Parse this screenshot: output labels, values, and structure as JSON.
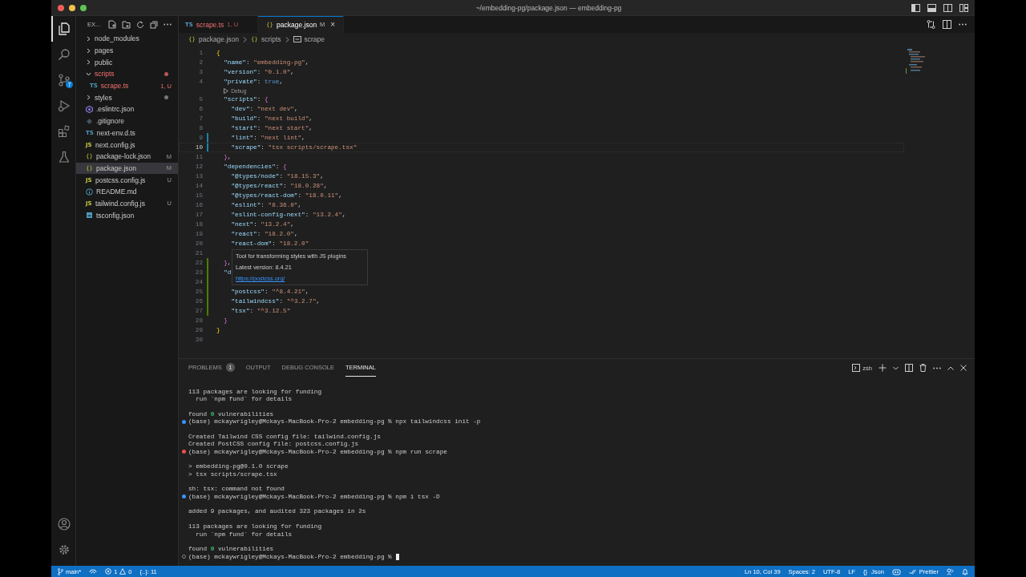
{
  "window": {
    "title": "~/embedding-pg/package.json — embedding-pg"
  },
  "activity_bar": {
    "items": [
      {
        "kind": "explorer",
        "selected": true
      },
      {
        "kind": "search",
        "selected": false
      },
      {
        "kind": "scm",
        "selected": false,
        "badge": "7"
      },
      {
        "kind": "debug",
        "selected": false
      },
      {
        "kind": "extensions",
        "selected": false
      },
      {
        "kind": "testing",
        "selected": false
      }
    ],
    "bottom": [
      {
        "kind": "account"
      },
      {
        "kind": "settings"
      }
    ]
  },
  "sidebar": {
    "title": "EX...",
    "items": [
      {
        "name": "node_modules",
        "kind": "folder",
        "expanded": false,
        "selected": false
      },
      {
        "name": "pages",
        "kind": "folder",
        "expanded": false,
        "selected": false
      },
      {
        "name": "public",
        "kind": "folder",
        "expanded": false,
        "selected": false
      },
      {
        "name": "scripts",
        "kind": "folder",
        "expanded": true,
        "selected": false,
        "error": true,
        "dot": true,
        "children": [
          {
            "name": "scrape.ts",
            "kind": "ts",
            "glyph": "TS",
            "error": true,
            "badge": "1, U",
            "selected": false
          }
        ]
      },
      {
        "name": "styles",
        "kind": "folder",
        "expanded": false,
        "selected": false,
        "dot": true
      },
      {
        "name": ".eslintrc.json",
        "kind": "eslint",
        "selected": false
      },
      {
        "name": ".gitignore",
        "kind": "git",
        "selected": false
      },
      {
        "name": "next-env.d.ts",
        "kind": "ts",
        "glyph": "TS",
        "selected": false
      },
      {
        "name": "next.config.js",
        "kind": "js",
        "glyph": "JS",
        "selected": false
      },
      {
        "name": "package-lock.json",
        "kind": "json",
        "glyph": "{}",
        "badge": "M",
        "selected": false
      },
      {
        "name": "package.json",
        "kind": "json",
        "glyph": "{}",
        "badge": "M",
        "selected": true
      },
      {
        "name": "postcss.config.js",
        "kind": "js",
        "glyph": "JS",
        "badge": "U",
        "selected": false
      },
      {
        "name": "README.md",
        "kind": "info",
        "selected": false
      },
      {
        "name": "tailwind.config.js",
        "kind": "js",
        "glyph": "JS",
        "badge": "U",
        "selected": false
      },
      {
        "name": "tsconfig.json",
        "kind": "tsconfig",
        "selected": false
      }
    ]
  },
  "tabs": [
    {
      "glyph": "TS",
      "kind": "ts",
      "label": "scrape.ts",
      "badge": "1, U",
      "error": true,
      "selected": false
    },
    {
      "glyph": "{}",
      "kind": "json",
      "label": "package.json",
      "badge": "M",
      "selected": true,
      "close": "×"
    }
  ],
  "breadcrumbs": [
    {
      "glyph": "{}",
      "label": "package.json"
    },
    {
      "glyph": "{}",
      "label": "scripts"
    },
    {
      "kind": "property",
      "label": "scrape"
    }
  ],
  "editor": {
    "lines": [
      {
        "kind": "line",
        "num": "1",
        "tokens": [
          {
            "kind": "brace1",
            "t": "{"
          }
        ],
        "children": [
          {
            "kind": "line",
            "num": "2",
            "tokens": [
              {
                "kind": "key",
                "t": "\"name\""
              },
              {
                "kind": "punct",
                "t": ": "
              },
              {
                "kind": "str",
                "t": "\"embedding-pg\""
              },
              {
                "kind": "punct",
                "t": ","
              }
            ]
          },
          {
            "kind": "line",
            "num": "3",
            "tokens": [
              {
                "kind": "key",
                "t": "\"version\""
              },
              {
                "kind": "punct",
                "t": ": "
              },
              {
                "kind": "str",
                "t": "\"0.1.0\""
              },
              {
                "kind": "punct",
                "t": ","
              }
            ]
          },
          {
            "kind": "line",
            "num": "4",
            "tokens": [
              {
                "kind": "key",
                "t": "\"private\""
              },
              {
                "kind": "punct",
                "t": ": "
              },
              {
                "kind": "bool",
                "t": "true"
              },
              {
                "kind": "punct",
                "t": ","
              }
            ]
          },
          {
            "kind": "codelens",
            "label": "Debug"
          },
          {
            "kind": "line",
            "num": "5",
            "tokens": [
              {
                "kind": "key",
                "t": "\"scripts\""
              },
              {
                "kind": "punct",
                "t": ": "
              },
              {
                "kind": "brace2",
                "t": "{"
              }
            ],
            "children": [
              {
                "kind": "line",
                "num": "6",
                "tokens": [
                  {
                    "kind": "key",
                    "t": "\"dev\""
                  },
                  {
                    "kind": "punct",
                    "t": ": "
                  },
                  {
                    "kind": "str",
                    "t": "\"next dev\""
                  },
                  {
                    "kind": "punct",
                    "t": ","
                  }
                ]
              },
              {
                "kind": "line",
                "num": "7",
                "tokens": [
                  {
                    "kind": "key",
                    "t": "\"build\""
                  },
                  {
                    "kind": "punct",
                    "t": ": "
                  },
                  {
                    "kind": "str",
                    "t": "\"next build\""
                  },
                  {
                    "kind": "punct",
                    "t": ","
                  }
                ]
              },
              {
                "kind": "line",
                "num": "8",
                "tokens": [
                  {
                    "kind": "key",
                    "t": "\"start\""
                  },
                  {
                    "kind": "punct",
                    "t": ": "
                  },
                  {
                    "kind": "str",
                    "t": "\"next start\""
                  },
                  {
                    "kind": "punct",
                    "t": ","
                  }
                ]
              },
              {
                "kind": "line",
                "num": "9",
                "changed": true,
                "tokens": [
                  {
                    "kind": "key",
                    "t": "\"lint\""
                  },
                  {
                    "kind": "punct",
                    "t": ": "
                  },
                  {
                    "kind": "str",
                    "t": "\"next lint\""
                  },
                  {
                    "kind": "punct",
                    "t": ","
                  }
                ]
              },
              {
                "kind": "line",
                "num": "10",
                "changed": true,
                "current": true,
                "tokens": [
                  {
                    "kind": "key",
                    "t": "\"scrape\""
                  },
                  {
                    "kind": "punct",
                    "t": ": "
                  },
                  {
                    "kind": "str",
                    "t": "\"tsx scripts/scrape.tsx\""
                  }
                ]
              }
            ]
          },
          {
            "kind": "line",
            "num": "11",
            "tokens": [
              {
                "kind": "brace2",
                "t": "}"
              },
              {
                "kind": "punct",
                "t": ","
              }
            ]
          },
          {
            "kind": "line",
            "num": "12",
            "tokens": [
              {
                "kind": "key",
                "t": "\"dependencies\""
              },
              {
                "kind": "punct",
                "t": ": "
              },
              {
                "kind": "brace2",
                "t": "{"
              }
            ],
            "children": [
              {
                "kind": "line",
                "num": "13",
                "tokens": [
                  {
                    "kind": "key",
                    "t": "\"@types/node\""
                  },
                  {
                    "kind": "punct",
                    "t": ": "
                  },
                  {
                    "kind": "str",
                    "t": "\"18.15.3\""
                  },
                  {
                    "kind": "punct",
                    "t": ","
                  }
                ]
              },
              {
                "kind": "line",
                "num": "14",
                "tokens": [
                  {
                    "kind": "key",
                    "t": "\"@types/react\""
                  },
                  {
                    "kind": "punct",
                    "t": ": "
                  },
                  {
                    "kind": "str",
                    "t": "\"18.0.28\""
                  },
                  {
                    "kind": "punct",
                    "t": ","
                  }
                ]
              },
              {
                "kind": "line",
                "num": "15",
                "tokens": [
                  {
                    "kind": "key",
                    "t": "\"@types/react-dom\""
                  },
                  {
                    "kind": "punct",
                    "t": ": "
                  },
                  {
                    "kind": "str",
                    "t": "\"18.0.11\""
                  },
                  {
                    "kind": "punct",
                    "t": ","
                  }
                ]
              },
              {
                "kind": "line",
                "num": "16",
                "tokens": [
                  {
                    "kind": "key",
                    "t": "\"eslint\""
                  },
                  {
                    "kind": "punct",
                    "t": ": "
                  },
                  {
                    "kind": "str",
                    "t": "\"8.36.0\""
                  },
                  {
                    "kind": "punct",
                    "t": ","
                  }
                ]
              },
              {
                "kind": "line",
                "num": "17",
                "tokens": [
                  {
                    "kind": "key",
                    "t": "\"eslint-config-next\""
                  },
                  {
                    "kind": "punct",
                    "t": ": "
                  },
                  {
                    "kind": "str",
                    "t": "\"13.2.4\""
                  },
                  {
                    "kind": "punct",
                    "t": ","
                  }
                ]
              },
              {
                "kind": "line",
                "num": "18",
                "tokens": [
                  {
                    "kind": "key",
                    "t": "\"next\""
                  },
                  {
                    "kind": "punct",
                    "t": ": "
                  },
                  {
                    "kind": "str",
                    "t": "\"13.2.4\""
                  },
                  {
                    "kind": "punct",
                    "t": ","
                  }
                ]
              },
              {
                "kind": "line",
                "num": "19",
                "tokens": [
                  {
                    "kind": "key",
                    "t": "\"react\""
                  },
                  {
                    "kind": "punct",
                    "t": ": "
                  },
                  {
                    "kind": "str",
                    "t": "\"18.2.0\""
                  },
                  {
                    "kind": "punct",
                    "t": ","
                  }
                ]
              },
              {
                "kind": "line",
                "num": "20",
                "tokens": [
                  {
                    "kind": "key",
                    "t": "\"react-dom\""
                  },
                  {
                    "kind": "punct",
                    "t": ": "
                  },
                  {
                    "kind": "str",
                    "t": "\"18.2.0\""
                  }
                ]
              },
              {
                "kind": "line",
                "num": "21"
              }
            ]
          },
          {
            "kind": "line",
            "num": "22",
            "added": true,
            "tokens": [
              {
                "kind": "brace2",
                "t": "}"
              },
              {
                "kind": "punct",
                "t": ","
              }
            ]
          },
          {
            "kind": "line",
            "num": "23",
            "added": true,
            "tokens": [
              {
                "kind": "key",
                "t": "\"d"
              }
            ],
            "children": [
              {
                "kind": "line",
                "num": "24",
                "added": true
              },
              {
                "kind": "line",
                "num": "25",
                "added": true,
                "tokens": [
                  {
                    "kind": "key",
                    "t": "\"postcss\""
                  },
                  {
                    "kind": "punct",
                    "t": ": "
                  },
                  {
                    "kind": "str",
                    "t": "\"^8.4.21\""
                  },
                  {
                    "kind": "punct",
                    "t": ","
                  }
                ]
              },
              {
                "kind": "line",
                "num": "26",
                "added": true,
                "tokens": [
                  {
                    "kind": "key",
                    "t": "\"tailwindcss\""
                  },
                  {
                    "kind": "punct",
                    "t": ": "
                  },
                  {
                    "kind": "str",
                    "t": "\"^3.2.7\""
                  },
                  {
                    "kind": "punct",
                    "t": ","
                  }
                ]
              },
              {
                "kind": "line",
                "num": "27",
                "added": true,
                "tokens": [
                  {
                    "kind": "key",
                    "t": "\"tsx\""
                  },
                  {
                    "kind": "punct",
                    "t": ": "
                  },
                  {
                    "kind": "str",
                    "t": "\"^3.12.5\""
                  }
                ]
              }
            ]
          },
          {
            "kind": "line",
            "num": "28",
            "tokens": [
              {
                "kind": "brace2",
                "t": "}"
              }
            ]
          }
        ]
      },
      {
        "kind": "line",
        "num": "29",
        "tokens": [
          {
            "kind": "brace1",
            "t": "}"
          }
        ]
      },
      {
        "kind": "line",
        "num": "30"
      }
    ],
    "hover": {
      "description": "Tool for transforming styles with JS plugins",
      "version": "Latest version: 8.4.21",
      "link": "https://postcss.org/"
    }
  },
  "panel": {
    "tabs": [
      {
        "label": "PROBLEMS",
        "badge": "1",
        "selected": false
      },
      {
        "label": "OUTPUT",
        "selected": false
      },
      {
        "label": "DEBUG CONSOLE",
        "selected": false
      },
      {
        "label": "TERMINAL",
        "selected": true
      }
    ],
    "shell": "zsh",
    "lines": [
      {
        "kind": "output",
        "segments": [
          {
            "t": "113 packages are looking for funding"
          }
        ]
      },
      {
        "kind": "output",
        "segments": [
          {
            "t": "  run `npm fund` for details"
          }
        ]
      },
      {
        "kind": "output",
        "blank_before": true,
        "segments": [
          {
            "t": "found "
          },
          {
            "t": "0",
            "kind": "ok"
          },
          {
            "t": " vulnerabilities"
          }
        ]
      },
      {
        "kind": "prompt_ok",
        "segments": [
          {
            "t": "(base) mckaywrigley@Mckays-MacBook-Pro-2 embedding-pg % npx tailwindcss init -p"
          }
        ]
      },
      {
        "kind": "output",
        "blank_before": true,
        "segments": [
          {
            "t": "Created Tailwind CSS config file: tailwind.config.js"
          }
        ]
      },
      {
        "kind": "output",
        "segments": [
          {
            "t": "Created PostCSS config file: postcss.config.js"
          }
        ]
      },
      {
        "kind": "prompt_error",
        "segments": [
          {
            "t": "(base) mckaywrigley@Mckays-MacBook-Pro-2 embedding-pg % npm run scrape"
          }
        ]
      },
      {
        "kind": "output",
        "blank_before": true,
        "segments": [
          {
            "t": "> embedding-pg@0.1.0 scrape"
          }
        ]
      },
      {
        "kind": "output",
        "segments": [
          {
            "t": "> tsx scripts/scrape.tsx"
          }
        ]
      },
      {
        "kind": "output",
        "blank_before": true,
        "segments": [
          {
            "t": "sh: tsx: command not found"
          }
        ]
      },
      {
        "kind": "prompt_ok",
        "segments": [
          {
            "t": "(base) mckaywrigley@Mckays-MacBook-Pro-2 embedding-pg % npm i tsx -D"
          }
        ]
      },
      {
        "kind": "output",
        "blank_before": true,
        "segments": [
          {
            "t": "added 9 packages, and audited 323 packages in 2s"
          }
        ]
      },
      {
        "kind": "output",
        "blank_before": true,
        "segments": [
          {
            "t": "113 packages are looking for funding"
          }
        ]
      },
      {
        "kind": "output",
        "segments": [
          {
            "t": "  run `npm fund` for details"
          }
        ]
      },
      {
        "kind": "output",
        "blank_before": true,
        "segments": [
          {
            "t": "found "
          },
          {
            "t": "0",
            "kind": "ok"
          },
          {
            "t": " vulnerabilities"
          }
        ]
      },
      {
        "kind": "prompt_open",
        "cursor": true,
        "segments": [
          {
            "t": "(base) mckaywrigley@Mckays-MacBook-Pro-2 embedding-pg %"
          }
        ]
      }
    ]
  },
  "status_bar": {
    "left": [
      {
        "kind": "branch",
        "text": "main*"
      },
      {
        "kind": "sync"
      },
      {
        "kind": "problems",
        "errors": "1",
        "warnings": "0"
      },
      {
        "kind": "text",
        "text": "{..}: 11"
      }
    ],
    "right": [
      {
        "kind": "text",
        "text": "Ln 10, Col 39"
      },
      {
        "kind": "text",
        "text": "Spaces: 2"
      },
      {
        "kind": "text",
        "text": "UTF-8"
      },
      {
        "kind": "text",
        "text": "LF"
      },
      {
        "kind": "lang",
        "glyph": "{}",
        "text": "Json"
      },
      {
        "kind": "copilot"
      },
      {
        "kind": "prettier",
        "text": "Prettier"
      },
      {
        "kind": "feedback"
      },
      {
        "kind": "bell"
      }
    ]
  }
}
